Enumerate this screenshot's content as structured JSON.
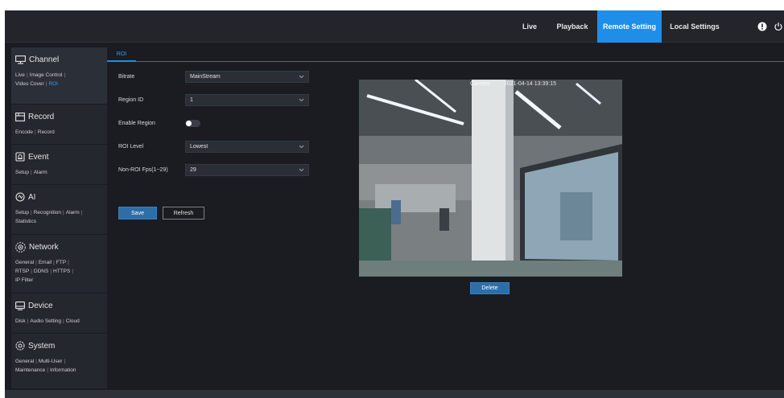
{
  "topnav": {
    "items": [
      {
        "label": "Live",
        "active": false
      },
      {
        "label": "Playback",
        "active": false
      },
      {
        "label": "Remote Setting",
        "active": true
      },
      {
        "label": "Local Settings",
        "active": false
      }
    ],
    "accent": "#1f8ee8"
  },
  "sidebar": {
    "sections": [
      {
        "title": "Channel",
        "icon": "channel-icon",
        "links": [
          "Live",
          "Image Control",
          "Video Cover",
          "ROI"
        ],
        "active_link": "ROI"
      },
      {
        "title": "Record",
        "icon": "record-icon",
        "links": [
          "Encode",
          "Record"
        ]
      },
      {
        "title": "Event",
        "icon": "event-icon",
        "links": [
          "Setup",
          "Alarm"
        ]
      },
      {
        "title": "AI",
        "icon": "ai-icon",
        "links": [
          "Setup",
          "Recognition",
          "Alarm",
          "Statistics"
        ]
      },
      {
        "title": "Network",
        "icon": "network-icon",
        "links": [
          "General",
          "Email",
          "FTP",
          "RTSP",
          "DDNS",
          "HTTPS",
          "IP Filter"
        ]
      },
      {
        "title": "Device",
        "icon": "device-icon",
        "links": [
          "Disk",
          "Audio Setting",
          "Cloud"
        ]
      },
      {
        "title": "System",
        "icon": "system-icon",
        "links": [
          "General",
          "Multi-User",
          "Maintenance",
          "Information"
        ]
      }
    ]
  },
  "tab": {
    "label": "ROI"
  },
  "form": {
    "bitrate": {
      "label": "Bitrate",
      "value": "MainStream"
    },
    "region_id": {
      "label": "Region ID",
      "value": "1"
    },
    "enable_region": {
      "label": "Enable Region",
      "enabled": false
    },
    "roi_level": {
      "label": "ROI Level",
      "value": "Lowest"
    },
    "non_roi_fps": {
      "label": "Non-ROI Fps(1~29)",
      "value": "29"
    }
  },
  "buttons": {
    "save": "Save",
    "refresh": "Refresh",
    "delete": "Delete"
  },
  "video": {
    "camera_label": "Camera",
    "timestamp": "2021-04-14 13:39:15"
  }
}
